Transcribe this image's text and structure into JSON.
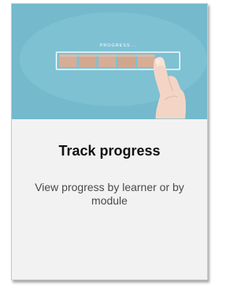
{
  "card": {
    "title": "Track progress",
    "description": "View progress by learner or by module",
    "image": {
      "overlay_text": "PROGRESS...",
      "icon": "hand-touching-progress-blocks"
    }
  },
  "colors": {
    "hero_background": "#74b9cc",
    "card_background": "#f2f2f2",
    "title": "#111111",
    "description": "#4a4a4a",
    "progress_block": "#d8ad96"
  }
}
